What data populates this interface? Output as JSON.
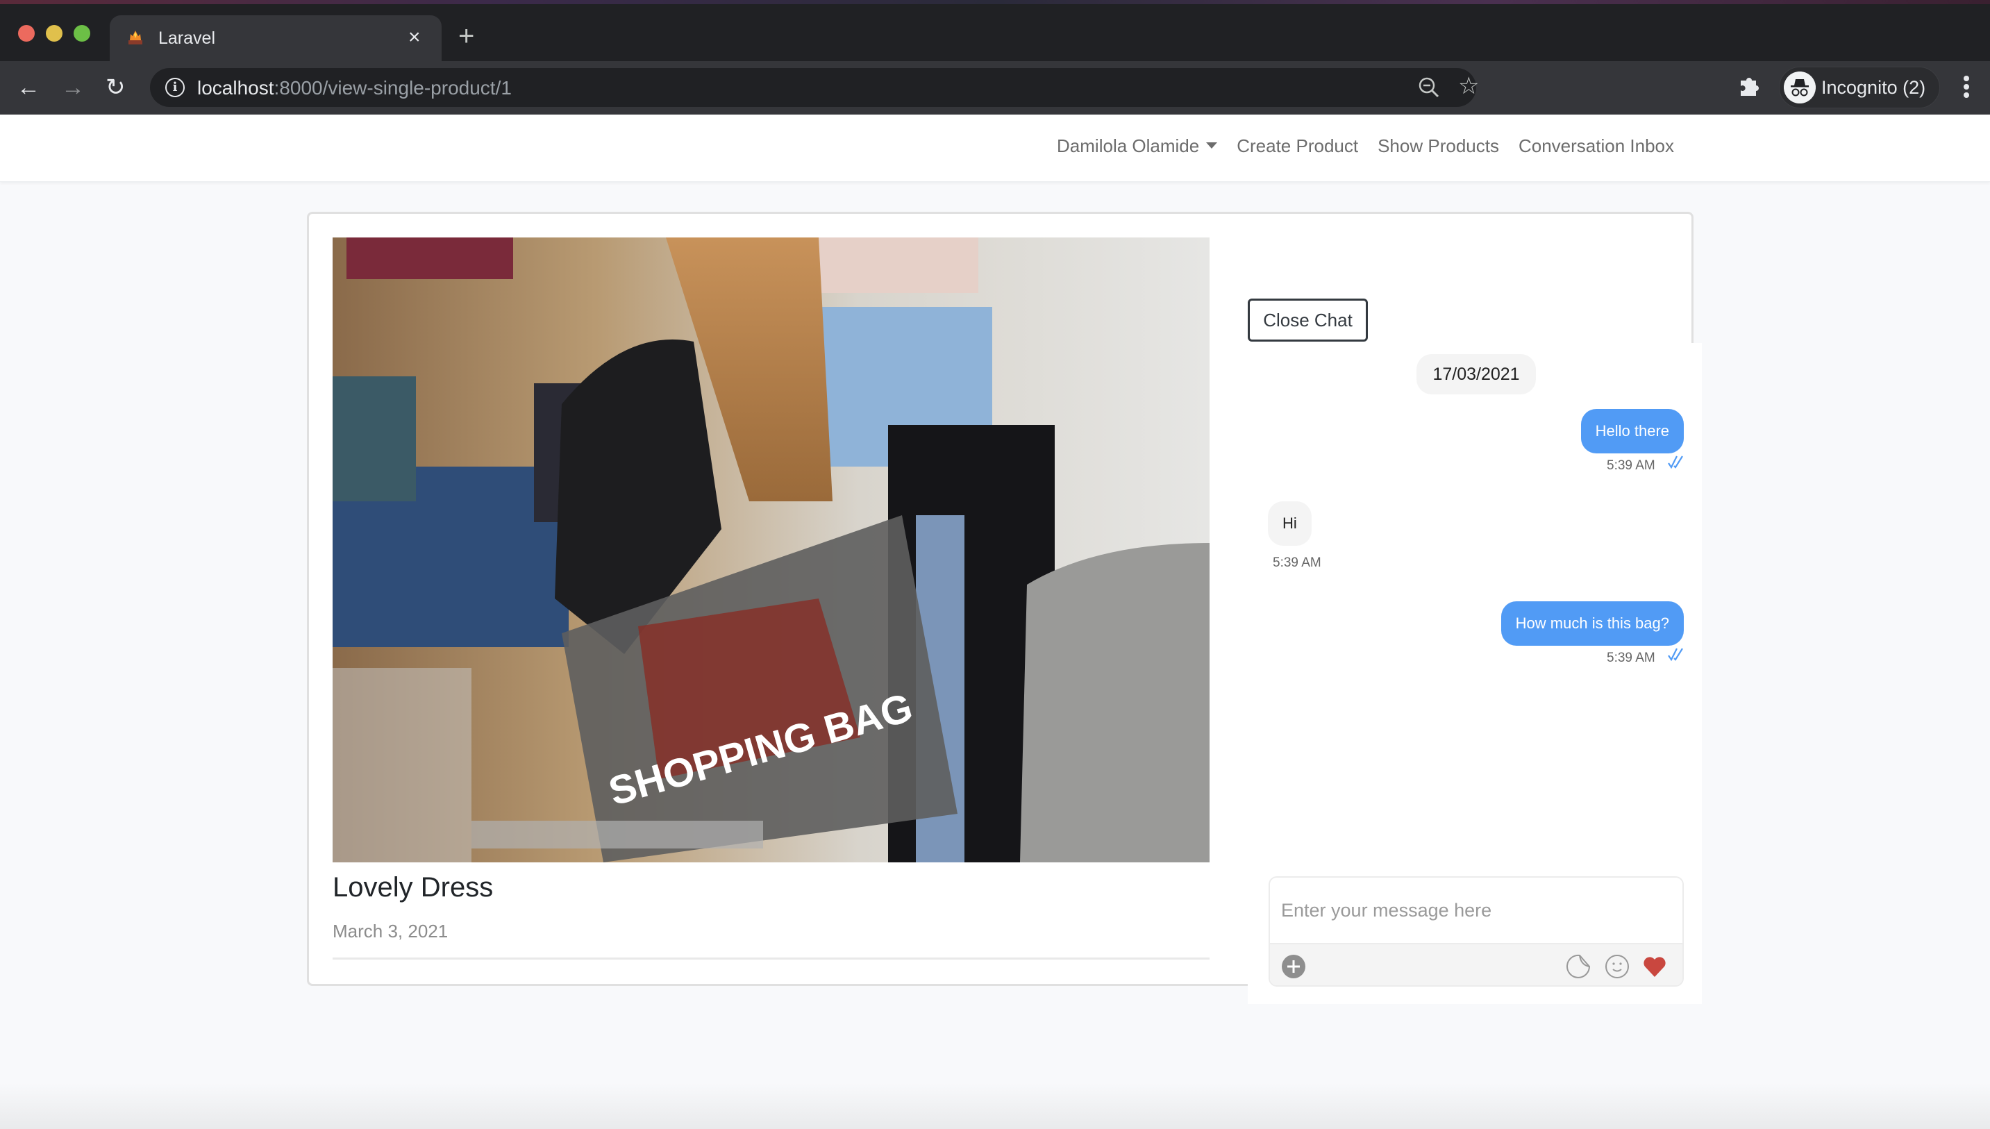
{
  "browser": {
    "tab_title": "Laravel",
    "tab_close": "×",
    "new_tab": "+",
    "url_host": "localhost",
    "url_rest": ":8000/view-single-product/1",
    "profile_label": "Incognito (2)",
    "icons": {
      "back": "back-arrow-icon",
      "forward": "forward-arrow-icon",
      "reload": "reload-icon",
      "info": "info-icon",
      "zoom": "zoom-out-icon",
      "bookmark": "star-icon",
      "extensions": "puzzle-icon",
      "incognito": "incognito-icon",
      "menu": "kebab-menu-icon"
    }
  },
  "navbar": {
    "user_menu": "Damilola Olamide",
    "links": [
      "Create Product",
      "Show Products",
      "Conversation Inbox"
    ]
  },
  "product": {
    "title": "Lovely Dress",
    "date": "March 3, 2021",
    "image_alt": "Shopper carrying a 'SHOPPING BAG' in a clothing store",
    "image_text": "SHOPPING BAG"
  },
  "chat": {
    "close_button": "Close Chat",
    "date_separator": "17/03/2021",
    "messages": [
      {
        "direction": "outgoing",
        "text": "Hello there",
        "time": "5:39 AM",
        "read": true
      },
      {
        "direction": "incoming",
        "text": "Hi",
        "time": "5:39 AM"
      },
      {
        "direction": "outgoing",
        "text": "How much is this bag?",
        "time": "5:39 AM",
        "read": true
      }
    ],
    "input_placeholder": "Enter your message here",
    "input_value": "",
    "toolbar_icons": [
      "add-attachment-icon",
      "sticker-icon",
      "emoji-icon",
      "heart-icon"
    ]
  },
  "colors": {
    "outgoing_bubble": "#519bf5",
    "incoming_bubble": "#f4f4f4",
    "heart": "#c9473f",
    "read_check": "#519bf5"
  }
}
